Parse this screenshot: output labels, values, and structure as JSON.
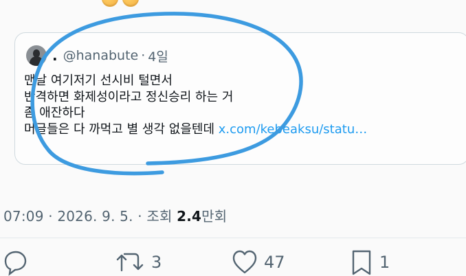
{
  "quote": {
    "display_name": ".",
    "handle": "@hanabute",
    "separator": "·",
    "time_ago": "4일",
    "lines": [
      "맨날 여기저기 선시비 털면서",
      "반격하면 화제성이라고 정신승리 하는 거",
      "좀 애잔하다",
      "머글들은 다 까먹고 별 생각 없을텐데"
    ],
    "link_text": "x.com/kebeaksu/statu…"
  },
  "meta": {
    "time": "07:09",
    "sep1": "·",
    "date": "2026. 9. 5.",
    "sep2": "·",
    "views_label": "조회",
    "views_value": "2.4",
    "views_unit": "만회"
  },
  "actions": {
    "reply": {
      "icon": "reply-icon",
      "count": ""
    },
    "repost": {
      "icon": "repost-icon",
      "count": "3"
    },
    "like": {
      "icon": "heart-icon",
      "count": "47"
    },
    "bookmark": {
      "icon": "bookmark-icon",
      "count": "1"
    }
  },
  "colors": {
    "accent_blue": "#1d9bf0",
    "scribble_blue": "#3d9be0",
    "secondary_text": "#536471",
    "primary_text": "#0f1419",
    "card_border": "#cfd9de"
  }
}
